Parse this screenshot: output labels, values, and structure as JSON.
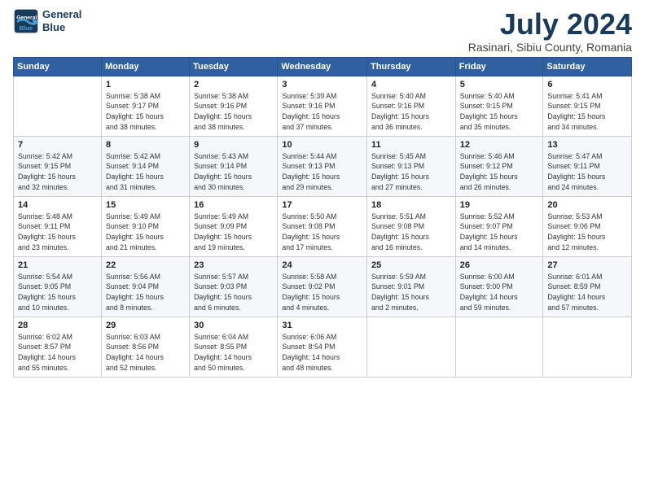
{
  "header": {
    "logo_line1": "General",
    "logo_line2": "Blue",
    "title": "July 2024",
    "subtitle": "Rasinari, Sibiu County, Romania"
  },
  "calendar": {
    "days_of_week": [
      "Sunday",
      "Monday",
      "Tuesday",
      "Wednesday",
      "Thursday",
      "Friday",
      "Saturday"
    ],
    "weeks": [
      [
        {
          "day": "",
          "info": ""
        },
        {
          "day": "1",
          "info": "Sunrise: 5:38 AM\nSunset: 9:17 PM\nDaylight: 15 hours\nand 38 minutes."
        },
        {
          "day": "2",
          "info": "Sunrise: 5:38 AM\nSunset: 9:16 PM\nDaylight: 15 hours\nand 38 minutes."
        },
        {
          "day": "3",
          "info": "Sunrise: 5:39 AM\nSunset: 9:16 PM\nDaylight: 15 hours\nand 37 minutes."
        },
        {
          "day": "4",
          "info": "Sunrise: 5:40 AM\nSunset: 9:16 PM\nDaylight: 15 hours\nand 36 minutes."
        },
        {
          "day": "5",
          "info": "Sunrise: 5:40 AM\nSunset: 9:15 PM\nDaylight: 15 hours\nand 35 minutes."
        },
        {
          "day": "6",
          "info": "Sunrise: 5:41 AM\nSunset: 9:15 PM\nDaylight: 15 hours\nand 34 minutes."
        }
      ],
      [
        {
          "day": "7",
          "info": "Sunrise: 5:42 AM\nSunset: 9:15 PM\nDaylight: 15 hours\nand 32 minutes."
        },
        {
          "day": "8",
          "info": "Sunrise: 5:42 AM\nSunset: 9:14 PM\nDaylight: 15 hours\nand 31 minutes."
        },
        {
          "day": "9",
          "info": "Sunrise: 5:43 AM\nSunset: 9:14 PM\nDaylight: 15 hours\nand 30 minutes."
        },
        {
          "day": "10",
          "info": "Sunrise: 5:44 AM\nSunset: 9:13 PM\nDaylight: 15 hours\nand 29 minutes."
        },
        {
          "day": "11",
          "info": "Sunrise: 5:45 AM\nSunset: 9:13 PM\nDaylight: 15 hours\nand 27 minutes."
        },
        {
          "day": "12",
          "info": "Sunrise: 5:46 AM\nSunset: 9:12 PM\nDaylight: 15 hours\nand 26 minutes."
        },
        {
          "day": "13",
          "info": "Sunrise: 5:47 AM\nSunset: 9:11 PM\nDaylight: 15 hours\nand 24 minutes."
        }
      ],
      [
        {
          "day": "14",
          "info": "Sunrise: 5:48 AM\nSunset: 9:11 PM\nDaylight: 15 hours\nand 23 minutes."
        },
        {
          "day": "15",
          "info": "Sunrise: 5:49 AM\nSunset: 9:10 PM\nDaylight: 15 hours\nand 21 minutes."
        },
        {
          "day": "16",
          "info": "Sunrise: 5:49 AM\nSunset: 9:09 PM\nDaylight: 15 hours\nand 19 minutes."
        },
        {
          "day": "17",
          "info": "Sunrise: 5:50 AM\nSunset: 9:08 PM\nDaylight: 15 hours\nand 17 minutes."
        },
        {
          "day": "18",
          "info": "Sunrise: 5:51 AM\nSunset: 9:08 PM\nDaylight: 15 hours\nand 16 minutes."
        },
        {
          "day": "19",
          "info": "Sunrise: 5:52 AM\nSunset: 9:07 PM\nDaylight: 15 hours\nand 14 minutes."
        },
        {
          "day": "20",
          "info": "Sunrise: 5:53 AM\nSunset: 9:06 PM\nDaylight: 15 hours\nand 12 minutes."
        }
      ],
      [
        {
          "day": "21",
          "info": "Sunrise: 5:54 AM\nSunset: 9:05 PM\nDaylight: 15 hours\nand 10 minutes."
        },
        {
          "day": "22",
          "info": "Sunrise: 5:56 AM\nSunset: 9:04 PM\nDaylight: 15 hours\nand 8 minutes."
        },
        {
          "day": "23",
          "info": "Sunrise: 5:57 AM\nSunset: 9:03 PM\nDaylight: 15 hours\nand 6 minutes."
        },
        {
          "day": "24",
          "info": "Sunrise: 5:58 AM\nSunset: 9:02 PM\nDaylight: 15 hours\nand 4 minutes."
        },
        {
          "day": "25",
          "info": "Sunrise: 5:59 AM\nSunset: 9:01 PM\nDaylight: 15 hours\nand 2 minutes."
        },
        {
          "day": "26",
          "info": "Sunrise: 6:00 AM\nSunset: 9:00 PM\nDaylight: 14 hours\nand 59 minutes."
        },
        {
          "day": "27",
          "info": "Sunrise: 6:01 AM\nSunset: 8:59 PM\nDaylight: 14 hours\nand 57 minutes."
        }
      ],
      [
        {
          "day": "28",
          "info": "Sunrise: 6:02 AM\nSunset: 8:57 PM\nDaylight: 14 hours\nand 55 minutes."
        },
        {
          "day": "29",
          "info": "Sunrise: 6:03 AM\nSunset: 8:56 PM\nDaylight: 14 hours\nand 52 minutes."
        },
        {
          "day": "30",
          "info": "Sunrise: 6:04 AM\nSunset: 8:55 PM\nDaylight: 14 hours\nand 50 minutes."
        },
        {
          "day": "31",
          "info": "Sunrise: 6:06 AM\nSunset: 8:54 PM\nDaylight: 14 hours\nand 48 minutes."
        },
        {
          "day": "",
          "info": ""
        },
        {
          "day": "",
          "info": ""
        },
        {
          "day": "",
          "info": ""
        }
      ]
    ]
  }
}
